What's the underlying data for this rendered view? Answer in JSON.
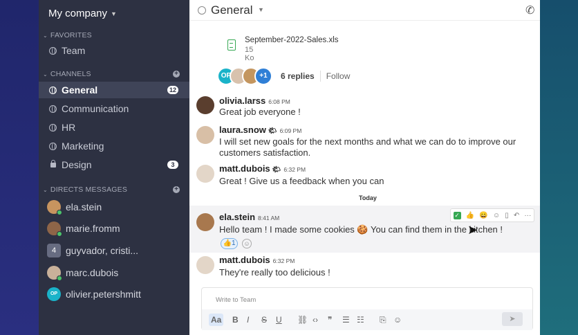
{
  "workspace": {
    "name": "My company"
  },
  "sidebar": {
    "favorites_title": "FAVORITES",
    "favorites": [
      {
        "label": "Team"
      }
    ],
    "channels_title": "CHANNELS",
    "channels": [
      {
        "label": "General",
        "badge": "12",
        "active": true
      },
      {
        "label": "Communication"
      },
      {
        "label": "HR"
      },
      {
        "label": "Marketing"
      },
      {
        "label": "Design",
        "badge": "3",
        "private": true
      }
    ],
    "directs_title": "DIRECTS MESSAGES",
    "directs": [
      {
        "label": "ela.stein"
      },
      {
        "label": "marie.fromm"
      },
      {
        "label": "guyvador, cristi...",
        "count": "4"
      },
      {
        "label": "marc.dubois"
      },
      {
        "label": "olivier.petershmitt",
        "initials": "OP"
      }
    ]
  },
  "channel": {
    "title": "General"
  },
  "attachment": {
    "name": "September-2022-Sales.xls",
    "size": "15 Ko"
  },
  "thread": {
    "avatar_initials": "OP",
    "extra": "+1",
    "replies": "6 replies",
    "follow": "Follow"
  },
  "messages": [
    {
      "user": "olivia.larss",
      "time": "6:08 PM",
      "text": "Great job everyone !"
    },
    {
      "user": "laura.snow",
      "time": "6:09 PM",
      "text": "I will set new goals for the next months and what we can do to improve our customers satisfaction."
    },
    {
      "user": "matt.dubois",
      "time": "6:32 PM",
      "text": "Great ! Give us a feedback when you can"
    },
    {
      "user": "ela.stein",
      "time": "8:41 AM",
      "text": "Hello team ! I made some cookies 🍪 You can find them in the kitchen !"
    },
    {
      "user": "matt.dubois",
      "time": "6:32 PM",
      "text": "They're really too delicious !"
    }
  ],
  "divider": "Today",
  "reaction": {
    "emoji": "👍",
    "count": "1"
  },
  "composer": {
    "placeholder": "Write to Team",
    "format_label": "Aa"
  },
  "colors": {
    "sidebar": "#2d3142",
    "accent": "#3f72c7",
    "online": "#4cc36b"
  }
}
